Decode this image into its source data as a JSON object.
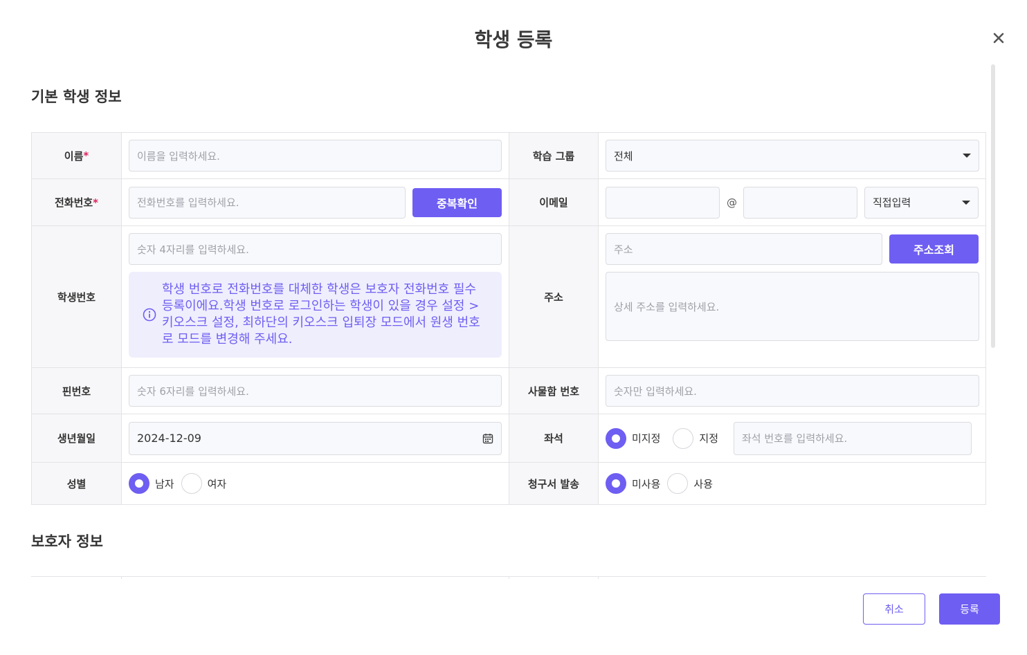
{
  "modal": {
    "title": "학생 등록"
  },
  "sections": {
    "basic": "기본 학생 정보",
    "guardian": "보호자 정보"
  },
  "fields": {
    "name": {
      "label": "이름",
      "required_mark": "*",
      "placeholder": "이름을 입력하세요."
    },
    "group": {
      "label": "학습 그룹",
      "value": "전체"
    },
    "phone": {
      "label": "전화번호",
      "required_mark": "*",
      "placeholder": "전화번호를 입력하세요.",
      "button": "중복확인"
    },
    "email": {
      "label": "이메일",
      "at": "@",
      "domain_select": "직접입력"
    },
    "student_no": {
      "label": "학생번호",
      "placeholder": "숫자 4자리를 입력하세요.",
      "info_lines": [
        "학생 번호로 전화번호를 대체한 학생은 보호자 전화번호 필수",
        "등록이에요.학생 번호로 로그인하는 학생이 있을 경우 설정 >",
        "키오스크 설정, 최하단의 키오스크 입퇴장 모드에서 원생 번호",
        "로 모드를 변경해 주세요."
      ]
    },
    "address": {
      "label": "주소",
      "placeholder": "주소",
      "button": "주소조회",
      "detail_placeholder": "상세 주소를 입력하세요."
    },
    "pin": {
      "label": "핀번호",
      "placeholder": "숫자 6자리를 입력하세요."
    },
    "locker": {
      "label": "사물함 번호",
      "placeholder": "숫자만 입력하세요."
    },
    "birth": {
      "label": "생년월일",
      "value": "2024-12-09"
    },
    "seat": {
      "label": "좌석",
      "options": [
        "미지정",
        "지정"
      ],
      "selected": "미지정",
      "placeholder": "좌석 번호를 입력하세요."
    },
    "gender": {
      "label": "성별",
      "options": [
        "남자",
        "여자"
      ],
      "selected": "남자"
    },
    "invoice": {
      "label": "청구서 발송",
      "options": [
        "미사용",
        "사용"
      ],
      "selected": "미사용"
    }
  },
  "footer": {
    "cancel": "취소",
    "submit": "등록"
  },
  "colors": {
    "accent": "#6e5ef2",
    "required": "#e0245e"
  }
}
